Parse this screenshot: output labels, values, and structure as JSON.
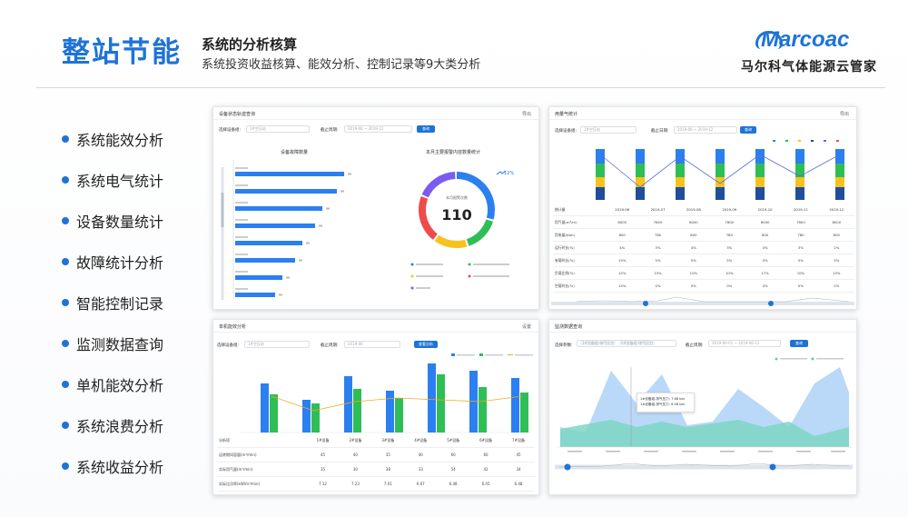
{
  "header": {
    "title": "整站节能",
    "subtitle": "系统的分析核算",
    "description": "系统投资收益核算、能效分析、控制记录等9大类分析",
    "logo_word": "Marcoac",
    "logo_cn": "马尔科气体能源云管家"
  },
  "menu": [
    "系统能效分析",
    "系统电气统计",
    "设备数量统计",
    "故障统计分析",
    "智能控制记录",
    "监测数据查询",
    "单机能效分析",
    "系统浪费分析",
    "系统收益分析"
  ],
  "colors": {
    "accent": "#1e73d8",
    "bar_blue": "#2b7ff0",
    "bar_green": "#2fbe55",
    "line_orange": "#f5a623",
    "yellow": "#f7c21e",
    "navy": "#1f4e9c"
  },
  "card1": {
    "title": "设备状态轨迹查询",
    "tool": "导出",
    "filter_label": "选择设备组:",
    "filter_value": "1#空压站",
    "date_label": "截止周期:",
    "date_value": "2019-06 ~ 2019-12",
    "query_btn": "查询",
    "left_title": "设备故障数量",
    "right_title": "本月主要报警内容数量统计",
    "donut_caption": "本月报警次数",
    "donut_total": "110",
    "trend": "12%"
  },
  "card2": {
    "title": "用量气统计",
    "tool": "导出",
    "filter_label": "选择设备组:",
    "filter_value": "1#空压站",
    "date_label": "截止日期:",
    "date_value": "2019-06 ~ 2019-12",
    "query_btn": "查询",
    "table_header": [
      "统计量",
      "2019-06",
      "2019-07",
      "2019-08",
      "2019-09",
      "2019-10",
      "2019-11",
      "2019-12"
    ],
    "table_rows": [
      [
        "用气量(m³/m)",
        "8000",
        "7800",
        "8000",
        "7800",
        "8000",
        "7800",
        "8000"
      ],
      [
        "用电量(kwh)",
        "800",
        "780",
        "800",
        "780",
        "800",
        "780",
        "800"
      ],
      [
        "运行时长(%)",
        "4%",
        "3%",
        "4%",
        "3%",
        "4%",
        "3%",
        "2%"
      ],
      [
        "有载时长(%)",
        "15%",
        "5%",
        "5%",
        "5%",
        "5%",
        "5%",
        "5%"
      ],
      [
        "负载比例(%)",
        "15%",
        "15%",
        "10%",
        "10%",
        "17%",
        "10%",
        "15%"
      ],
      [
        "空载时长(%)",
        "15%",
        "0%",
        "0%",
        "0%",
        "0%",
        "0%",
        "0%"
      ]
    ]
  },
  "card3": {
    "title": "单机能效分析",
    "tool": "设置",
    "filter_label": "选择设备组:",
    "filter_value": "1#空压站",
    "date_label": "截止周期:",
    "date_value": "2019-06",
    "query_btn": "查看分析",
    "table_header": [
      "分析项",
      "1#设备",
      "2#设备",
      "3#设备",
      "4#设备",
      "5#设备",
      "6#设备",
      "7#设备"
    ],
    "table_rows": [
      [
        "运转期间容量(m³/min)",
        "45",
        "40",
        "35",
        "40",
        "60",
        "60",
        "45"
      ],
      [
        "实际用气量(m³/min)",
        "35",
        "30",
        "38",
        "33",
        "54",
        "42",
        "34"
      ],
      [
        "实际比功率(kW/m³/min)",
        "7.12",
        "7.23",
        "7.01",
        "6.67",
        "6.48",
        "6.45",
        "6.48"
      ]
    ]
  },
  "card4": {
    "title": "监测数据查询",
    "filter_label": "选择参数:",
    "tag1": "1#设备组-排气压力",
    "tag2": "1#设备组-排气压力",
    "date_label": "截止周期:",
    "date_value": "2019-06-01 ~ 2019-06-12",
    "query_btn": "查询",
    "tooltip_line1": "1#设备组-排气压力: 7.68 bar",
    "tooltip_line2": "1#设备组-排气压力: 6.08 bar"
  }
}
